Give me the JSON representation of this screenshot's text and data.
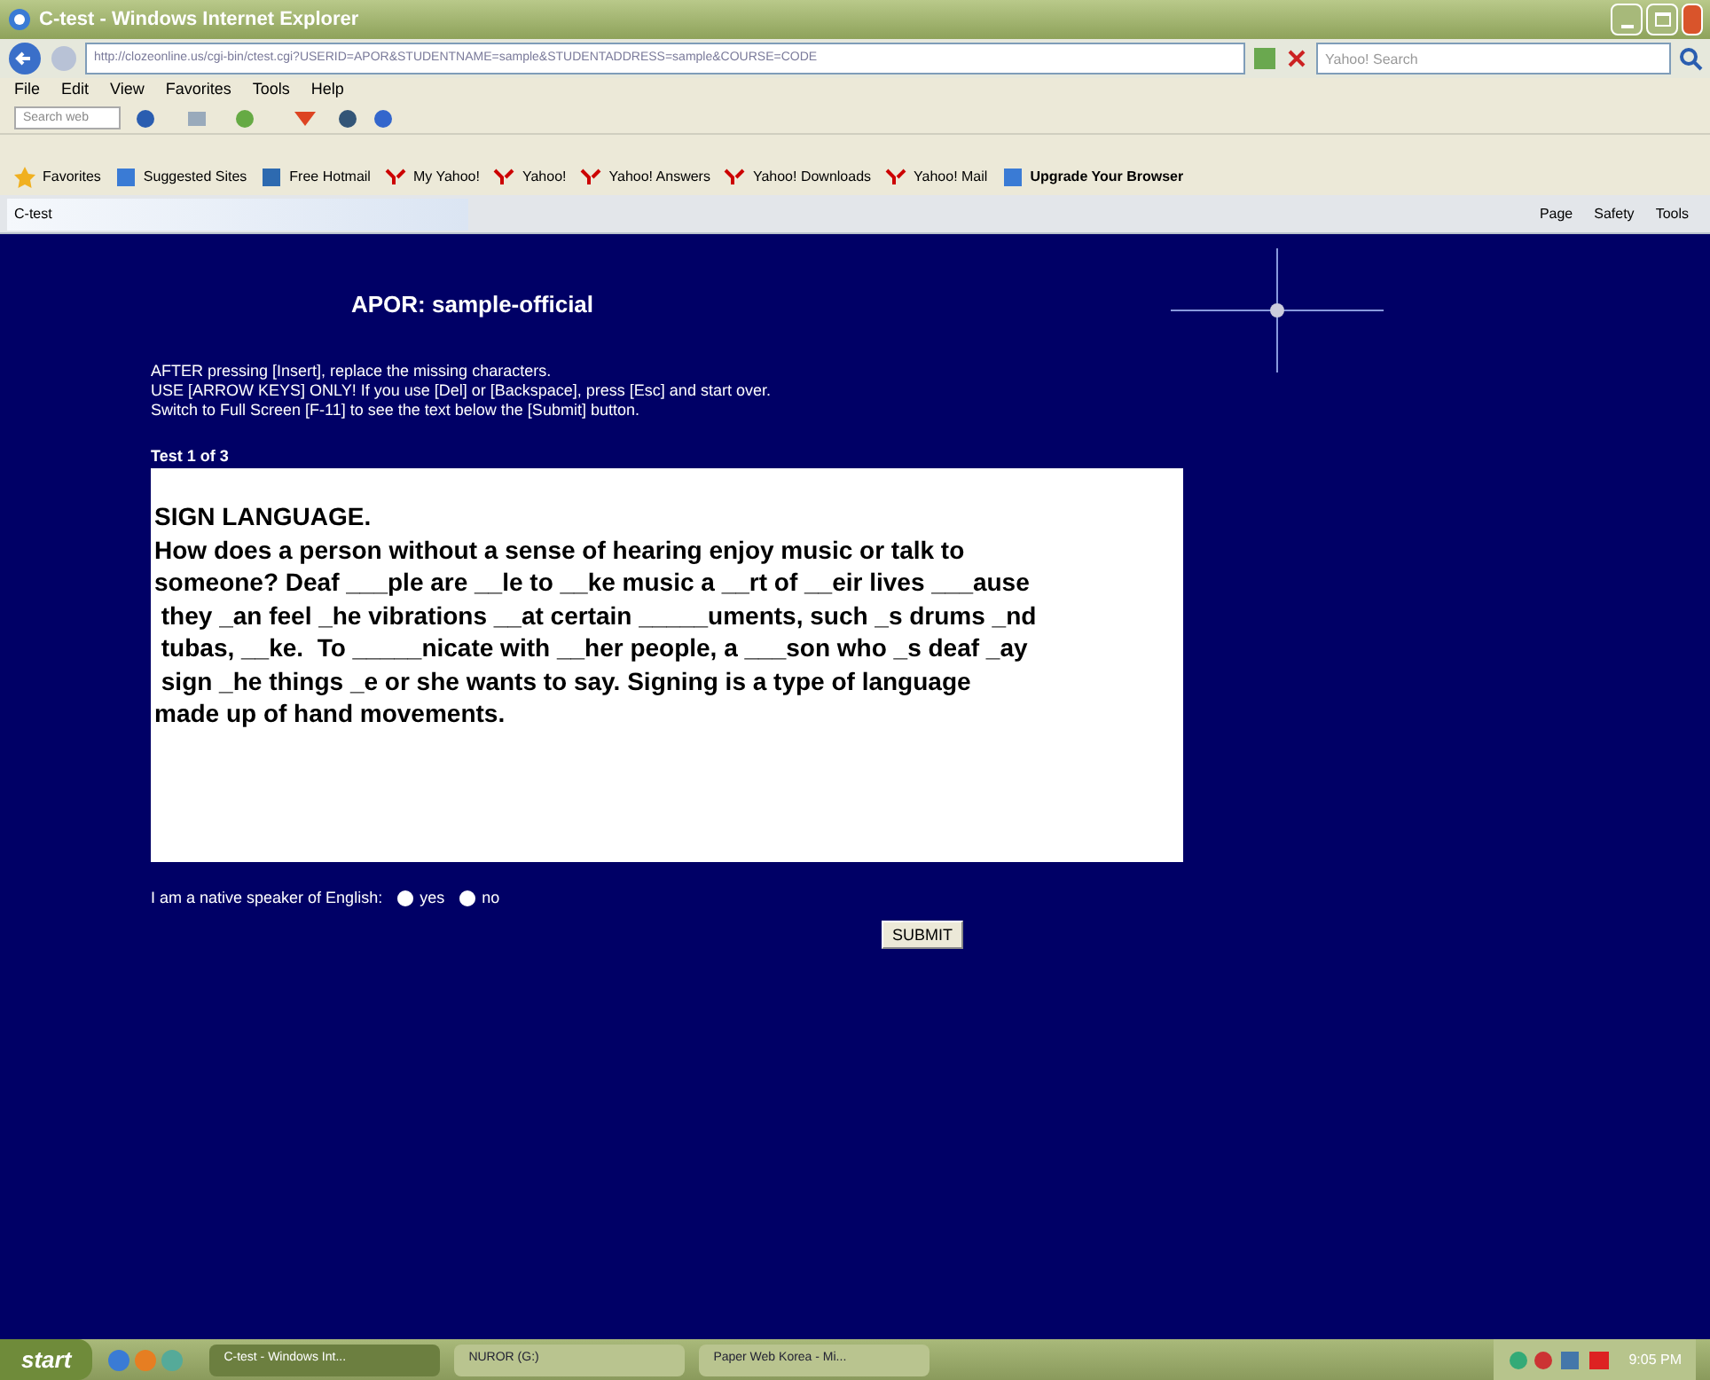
{
  "window": {
    "title": "C-test - Windows Internet Explorer"
  },
  "address": "http://clozeonline.us/cgi-bin/ctest.cgi?USERID=APOR&STUDENTNAME=sample&STUDENTADDRESS=sample&COURSE=CODE",
  "search_box": {
    "placeholder": "Yahoo! Search"
  },
  "menu": [
    "File",
    "Edit",
    "View",
    "Favorites",
    "Tools",
    "Help"
  ],
  "toolbar_search": {
    "placeholder": "Search web"
  },
  "favorites": [
    {
      "label": "Favorites",
      "kind": "star"
    },
    {
      "label": "Suggested Sites",
      "kind": "ie"
    },
    {
      "label": "Free Hotmail",
      "kind": "msn"
    },
    {
      "label": "My Yahoo!",
      "kind": "yahoo"
    },
    {
      "label": "Yahoo!",
      "kind": "yahoo"
    },
    {
      "label": "Yahoo! Answers",
      "kind": "yahoo"
    },
    {
      "label": "Yahoo! Downloads",
      "kind": "yahoo"
    },
    {
      "label": "Yahoo! Mail",
      "kind": "yahoo"
    },
    {
      "label": "Upgrade Your Browser",
      "kind": "ie"
    }
  ],
  "tab": {
    "title": "C-test"
  },
  "commands": [
    "Page",
    "Safety",
    "Tools"
  ],
  "page": {
    "heading": "APOR: sample-official",
    "instructions": [
      "AFTER pressing [Insert], replace the missing characters.",
      "USE [ARROW KEYS] ONLY! If you use [Del] or [Backspace], press [Esc] and start over.",
      "Switch to Full Screen [F-11] to see the text below the [Submit] button."
    ],
    "test_label": "Test 1 of 3",
    "text_lines": [
      "SIGN LANGUAGE.",
      "How does a person without a sense of hearing enjoy music or talk to",
      "someone? Deaf ___ple are __le to __ke music a __rt of __eir lives ___ause",
      " they _an feel _he vibrations __at certain _____uments, such _s drums _nd",
      " tubas, __ke.  To _____nicate with __her people, a ___son who _s deaf _ay",
      " sign _he things _e or she wants to say. Signing is a type of language",
      "made up of hand movements."
    ],
    "native_question": "I am a native speaker of English:",
    "options": [
      {
        "label": "yes",
        "selected": false
      },
      {
        "label": "no",
        "selected": false
      }
    ],
    "submit": "SUBMIT"
  },
  "taskbar": {
    "start": "start",
    "tasks": [
      "C-test - Windows Int...",
      "NUROR (G:)",
      "Paper Web Korea - Mi..."
    ],
    "clock": "9:05 PM"
  }
}
